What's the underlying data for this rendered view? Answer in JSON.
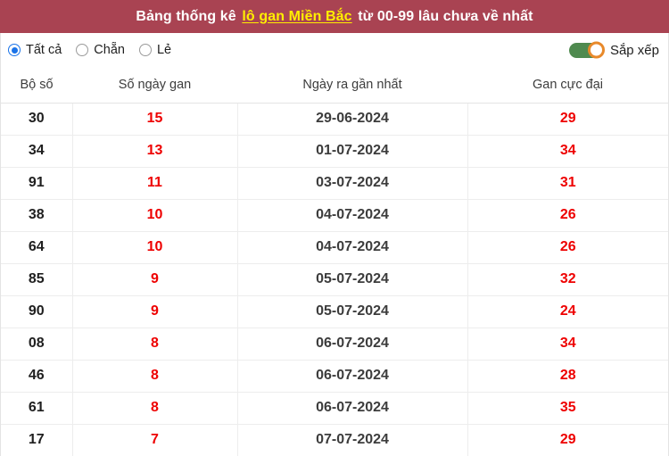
{
  "banner": {
    "text_before": "Bảng thống kê",
    "link_text": "lô gan Miền Bắc",
    "text_after": "từ 00-99 lâu chưa về nhất",
    "bg_color": "#a94352",
    "link_color": "#ffee00"
  },
  "controls": {
    "filters": [
      {
        "label": "Tất cả",
        "checked": true
      },
      {
        "label": "Chẵn",
        "checked": false
      },
      {
        "label": "Lẻ",
        "checked": false
      }
    ],
    "sort": {
      "label": "Sắp xếp",
      "enabled": true,
      "track_color": "#4f8a4f",
      "knob_ring_color": "#e8892a"
    }
  },
  "table": {
    "headers": [
      "Bộ số",
      "Số ngày gan",
      "Ngày ra gần nhất",
      "Gan cực đại"
    ],
    "rows": [
      {
        "bo_so": "30",
        "so_ngay_gan": "15",
        "ngay_ra_gan_nhat": "29-06-2024",
        "gan_cuc_dai": "29"
      },
      {
        "bo_so": "34",
        "so_ngay_gan": "13",
        "ngay_ra_gan_nhat": "01-07-2024",
        "gan_cuc_dai": "34"
      },
      {
        "bo_so": "91",
        "so_ngay_gan": "11",
        "ngay_ra_gan_nhat": "03-07-2024",
        "gan_cuc_dai": "31"
      },
      {
        "bo_so": "38",
        "so_ngay_gan": "10",
        "ngay_ra_gan_nhat": "04-07-2024",
        "gan_cuc_dai": "26"
      },
      {
        "bo_so": "64",
        "so_ngay_gan": "10",
        "ngay_ra_gan_nhat": "04-07-2024",
        "gan_cuc_dai": "26"
      },
      {
        "bo_so": "85",
        "so_ngay_gan": "9",
        "ngay_ra_gan_nhat": "05-07-2024",
        "gan_cuc_dai": "32"
      },
      {
        "bo_so": "90",
        "so_ngay_gan": "9",
        "ngay_ra_gan_nhat": "05-07-2024",
        "gan_cuc_dai": "24"
      },
      {
        "bo_so": "08",
        "so_ngay_gan": "8",
        "ngay_ra_gan_nhat": "06-07-2024",
        "gan_cuc_dai": "34"
      },
      {
        "bo_so": "46",
        "so_ngay_gan": "8",
        "ngay_ra_gan_nhat": "06-07-2024",
        "gan_cuc_dai": "28"
      },
      {
        "bo_so": "61",
        "so_ngay_gan": "8",
        "ngay_ra_gan_nhat": "06-07-2024",
        "gan_cuc_dai": "35"
      },
      {
        "bo_so": "17",
        "so_ngay_gan": "7",
        "ngay_ra_gan_nhat": "07-07-2024",
        "gan_cuc_dai": "29"
      }
    ]
  }
}
